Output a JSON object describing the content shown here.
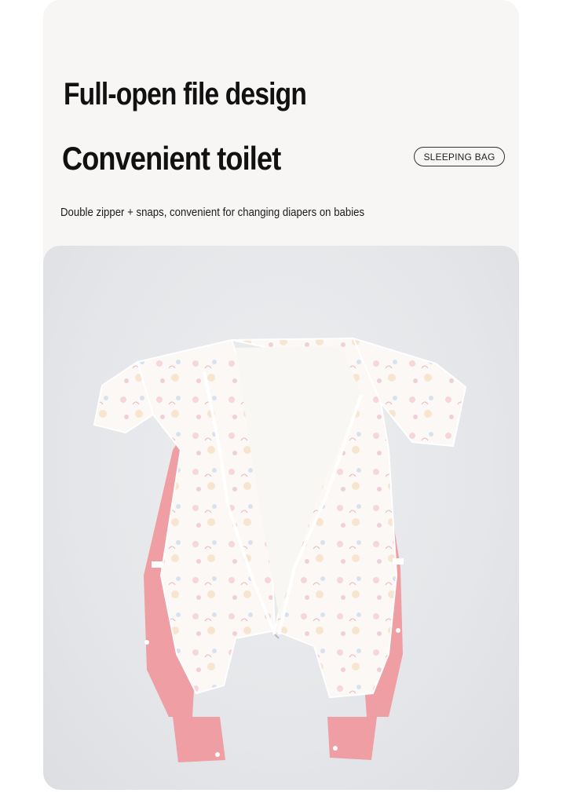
{
  "title_line1": "Full-open file design",
  "title_line2": "Convenient toilet",
  "badge": "SLEEPING BAG",
  "subtitle": "Double zipper + snaps, convenient for changing diapers on babies",
  "photo": {
    "subject": "baby-romper",
    "colors": {
      "accent_pink": "#ef9ea3",
      "fabric": "#fbf8f6",
      "background": "#e6e8eb"
    }
  }
}
